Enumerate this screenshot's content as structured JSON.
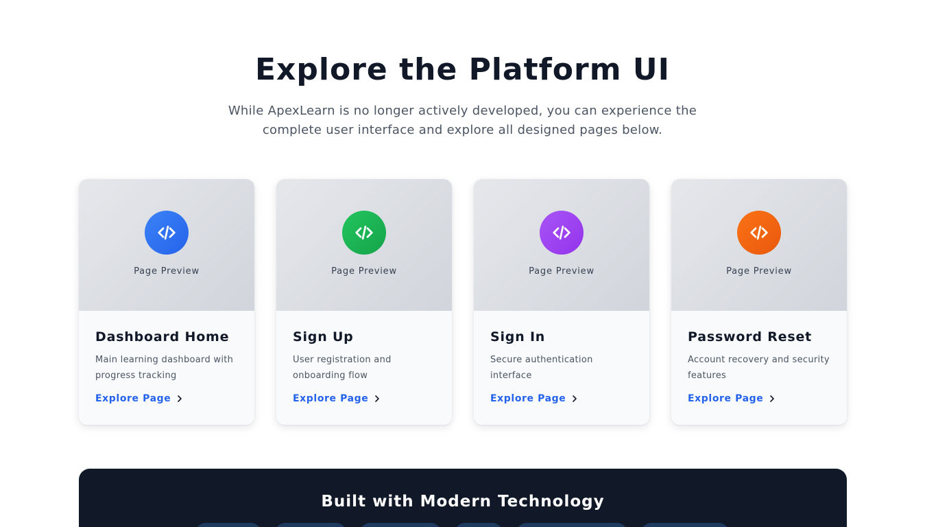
{
  "hero": {
    "title": "Explore the Platform UI",
    "subtitle": "While ApexLearn is no longer actively developed, you can experience the complete user interface and explore all designed pages below."
  },
  "cards": [
    {
      "preview_label": "Page Preview",
      "title": "Dashboard Home",
      "description": "Main learning dashboard with progress tracking",
      "link": "Explore Page",
      "icon": "code-icon",
      "accent": "#2563eb"
    },
    {
      "preview_label": "Page Preview",
      "title": "Sign Up",
      "description": "User registration and onboarding flow",
      "link": "Explore Page",
      "icon": "code-icon",
      "accent": "#16a34a"
    },
    {
      "preview_label": "Page Preview",
      "title": "Sign In",
      "description": "Secure authentication interface",
      "link": "Explore Page",
      "icon": "code-icon",
      "accent": "#9333ea"
    },
    {
      "preview_label": "Page Preview",
      "title": "Password Reset",
      "description": "Account recovery and security features",
      "link": "Explore Page",
      "icon": "code-icon",
      "accent": "#ea580c"
    }
  ],
  "tech": {
    "title": "Built with Modern Technology"
  },
  "colors": {
    "link": "#2563eb",
    "dark_panel": "#111827"
  }
}
